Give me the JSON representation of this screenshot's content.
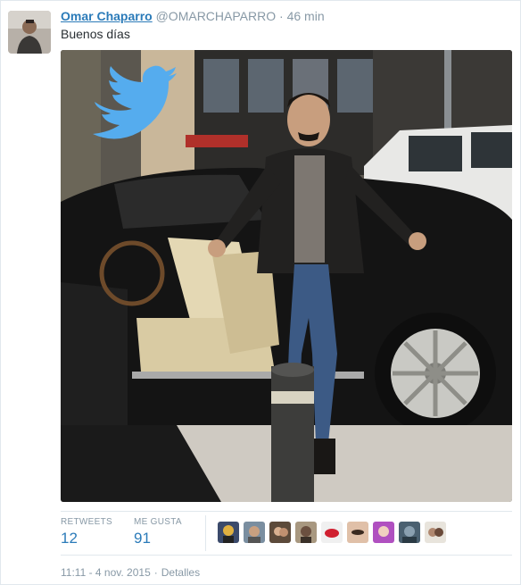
{
  "tweet": {
    "author_name": "Omar Chaparro",
    "handle": "@OMARCHAPARRO",
    "separator": "·",
    "time_ago": "46 min",
    "text": "Buenos días"
  },
  "stats": {
    "retweets_label": "RETWEETS",
    "retweets_count": "12",
    "likes_label": "ME GUSTA",
    "likes_count": "91"
  },
  "footer": {
    "timestamp": "11:11 - 4 nov. 2015",
    "separator": "·",
    "details_label": "Detalles"
  },
  "photo": {
    "twitter_bird_color": "#55acee"
  },
  "likers": [
    "liker-avatar-1",
    "liker-avatar-2",
    "liker-avatar-3",
    "liker-avatar-4",
    "liker-avatar-5",
    "liker-avatar-6",
    "liker-avatar-7",
    "liker-avatar-8",
    "liker-avatar-9"
  ]
}
